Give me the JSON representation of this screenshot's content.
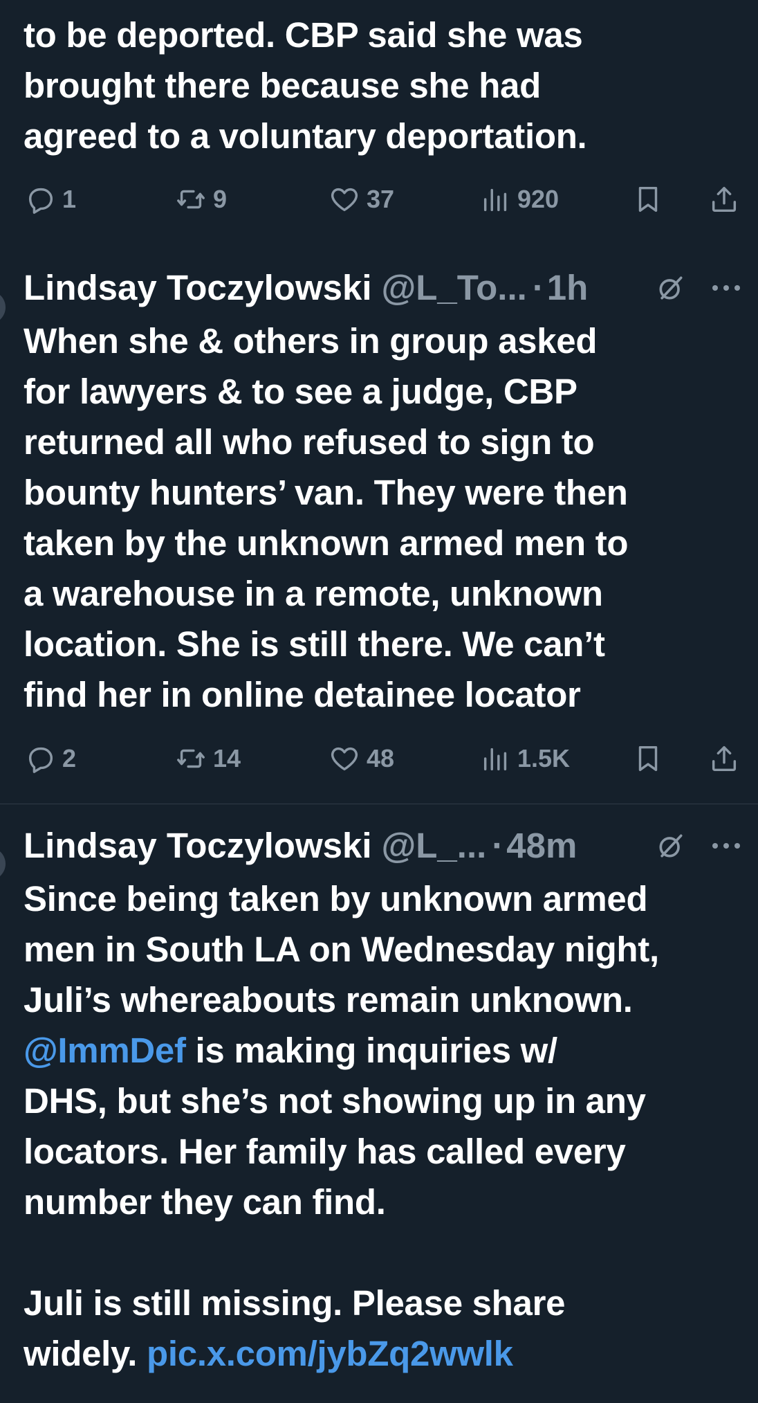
{
  "tweets": [
    {
      "text": "to be deported. CBP said she was\nbrought there because she had\nagreed to a voluntary deportation.",
      "actions": {
        "replies": "1",
        "reposts": "9",
        "likes": "37",
        "views": "920"
      }
    },
    {
      "author": {
        "name": "Lindsay Toczylowski",
        "handle": "@L_To...",
        "time": "1h"
      },
      "text": "When she & others in group asked\nfor lawyers & to see a judge, CBP\nreturned all who refused to sign to\nbounty hunters’ van. They were then\ntaken by the unknown armed men to\na warehouse in a remote, unknown\nlocation. She is still there. We can’t\nfind her in online detainee locator",
      "actions": {
        "replies": "2",
        "reposts": "14",
        "likes": "48",
        "views": "1.5K"
      }
    },
    {
      "author": {
        "name": "Lindsay Toczylowski",
        "handle": "@L_...",
        "time": "48m"
      },
      "text_before_mention": "Since being taken by unknown armed\nmen in South LA on Wednesday night,\nJuli’s whereabouts remain unknown.\n",
      "mention": "@ImmDef",
      "text_after_mention": " is making inquiries w/\nDHS, but she’s not showing up in any\nlocators. Her family has called every\nnumber they can find.\n\nJuli is still missing. Please share\nwidely. ",
      "link": "pic.x.com/jybZq2wwlk"
    }
  ],
  "dot_separator": "·",
  "icons": [
    "reply-icon",
    "repost-icon",
    "like-icon",
    "views-icon",
    "bookmark-icon",
    "share-icon",
    "grok-icon",
    "more-icon"
  ],
  "colors": {
    "background": "#15202b",
    "text": "#ffffff",
    "muted": "#8b98a5",
    "link": "#4a99e9"
  }
}
